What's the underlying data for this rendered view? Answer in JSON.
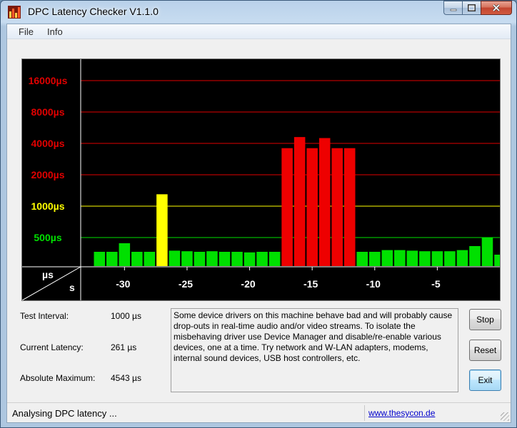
{
  "window": {
    "title": "DPC Latency Checker V1.1.0"
  },
  "menu": {
    "file": "File",
    "info": "Info"
  },
  "chart_data": {
    "type": "bar",
    "y_ticks": [
      {
        "label": "16000µs",
        "color": "#e00000"
      },
      {
        "label": "8000µs",
        "color": "#e00000"
      },
      {
        "label": "4000µs",
        "color": "#e00000"
      },
      {
        "label": "2000µs",
        "color": "#e00000"
      },
      {
        "label": "1000µs",
        "color": "#ffff00"
      },
      {
        "label": "500µs",
        "color": "#00e000"
      }
    ],
    "y_tick_values": [
      16000,
      8000,
      4000,
      2000,
      1000,
      500
    ],
    "unit_y": "µs",
    "unit_x": "s",
    "x_tick_labels": [
      "-30",
      "-25",
      "-20",
      "-15",
      "-10",
      "-5"
    ],
    "x_tick_values": [
      -30,
      -25,
      -20,
      -15,
      -10,
      -5
    ],
    "x_range": [
      -33,
      0
    ],
    "bar_times": [
      -32,
      -31,
      -30,
      -29,
      -28,
      -27,
      -26,
      -25,
      -24,
      -23,
      -22,
      -21,
      -20,
      -19,
      -18,
      -17,
      -16,
      -15,
      -14,
      -13,
      -12,
      -11,
      -10,
      -9,
      -8,
      -7,
      -6,
      -5,
      -4,
      -3,
      -2,
      -1,
      0
    ],
    "values": [
      250,
      250,
      400,
      250,
      250,
      1300,
      270,
      260,
      250,
      260,
      250,
      250,
      240,
      250,
      250,
      3600,
      4600,
      3600,
      4500,
      3600,
      3600,
      250,
      250,
      280,
      280,
      270,
      260,
      260,
      260,
      280,
      350,
      500,
      200
    ],
    "colors": {
      "green": "#00e000",
      "yellow": "#ffff00",
      "red": "#ee0000"
    }
  },
  "info": {
    "test_interval_label": "Test Interval:",
    "test_interval_value": "1000 µs",
    "current_latency_label": "Current Latency:",
    "current_latency_value": "261 µs",
    "absolute_max_label": "Absolute Maximum:",
    "absolute_max_value": "4543 µs",
    "message": "Some device drivers on this machine behave bad and will probably cause drop-outs in real-time audio and/or video streams. To isolate the misbehaving driver use Device Manager and disable/re-enable various devices, one at a time. Try network and W-LAN adapters, modems, internal sound devices, USB host controllers, etc."
  },
  "buttons": {
    "stop": "Stop",
    "reset": "Reset",
    "exit": "Exit"
  },
  "status": {
    "text": "Analysing DPC latency ...",
    "link": "www.thesycon.de"
  }
}
